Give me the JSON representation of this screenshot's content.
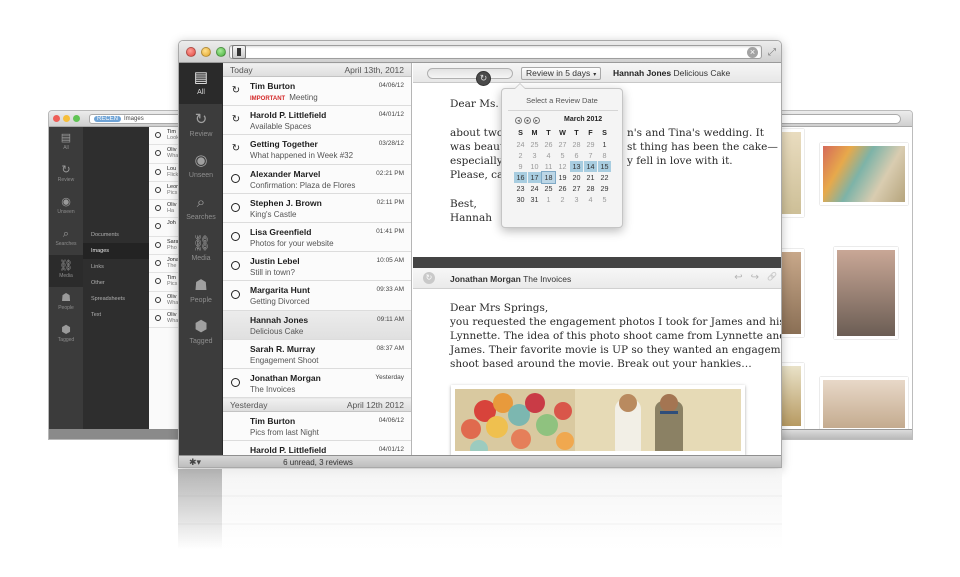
{
  "colors": {
    "sidebar_bg": "#3c3c3c",
    "important": "#d42a2a",
    "selected_day": "#a8cde0",
    "light_red": "#ee5e57",
    "light_yellow": "#f6be3a",
    "light_green": "#60c454"
  },
  "icons": {
    "clear": "×",
    "expand": "⤢",
    "gear": "✱▾",
    "review_loop": "↻",
    "reply": "↩",
    "forward": "↪",
    "attach": "🔗"
  },
  "back_left": {
    "search_pill": "RECEN",
    "search_text": "Images",
    "sidebar": [
      "All",
      "Review",
      "Unseen",
      "Searches",
      "Media",
      "People",
      "Tagged"
    ],
    "sublist": [
      "Documents",
      "Images",
      "Links",
      "Other",
      "Spreadsheets",
      "Text"
    ],
    "rows": [
      {
        "a": "Tim",
        "b": "Look"
      },
      {
        "a": "Oliv",
        "b": "Wha"
      },
      {
        "a": "Lou",
        "b": "Flick"
      },
      {
        "a": "Leon",
        "b": "Pics"
      },
      {
        "a": "Oliv",
        "b": "Ha"
      },
      {
        "a": "Joh",
        "b": ""
      },
      {
        "a": "Sara",
        "b": "Pho"
      },
      {
        "a": "Jona",
        "b": "The"
      },
      {
        "a": "Tim",
        "b": "Pics"
      },
      {
        "a": "Oliv",
        "b": "Wha"
      },
      {
        "a": "Oliv",
        "b": "Wha"
      }
    ]
  },
  "main": {
    "sidebar": [
      {
        "label": "All",
        "glyph": "▤"
      },
      {
        "label": "Review",
        "glyph": "↻"
      },
      {
        "label": "Unseen",
        "glyph": "◉"
      },
      {
        "label": "Searches",
        "glyph": "⌕"
      },
      {
        "label": "Media",
        "glyph": "⛓"
      },
      {
        "label": "People",
        "glyph": "☗"
      },
      {
        "label": "Tagged",
        "glyph": "⬢"
      }
    ],
    "groups": {
      "today": {
        "label": "Today",
        "date": "April 13th, 2012"
      },
      "yesterday": {
        "label": "Yesterday",
        "date": "April 12th 2012"
      }
    },
    "messages": [
      {
        "from": "Tim Burton",
        "important": "IMPORTANT",
        "subject": "Meeting",
        "date": "04/06/12",
        "state": "review"
      },
      {
        "from": "Harold P. Littlefield",
        "important": "",
        "subject": "Available Spaces",
        "date": "04/01/12",
        "state": "review"
      },
      {
        "from": "Getting Together",
        "important": "",
        "subject": "What happened in Week #32",
        "date": "03/28/12",
        "state": "review"
      },
      {
        "from": "Alexander Marvel",
        "important": "",
        "subject": "Confirmation: Plaza de Flores",
        "date": "02:21 PM",
        "state": "circle"
      },
      {
        "from": "Stephen J. Brown",
        "important": "",
        "subject": "King's Castle",
        "date": "02:11 PM",
        "state": "circle"
      },
      {
        "from": "Lisa Greenfield",
        "important": "",
        "subject": "Photos for your website",
        "date": "01:41 PM",
        "state": "circle"
      },
      {
        "from": "Justin Lebel",
        "important": "",
        "subject": "Still in town?",
        "date": "10:05 AM",
        "state": "circle"
      },
      {
        "from": "Margarita Hunt",
        "important": "",
        "subject": "Getting Divorced",
        "date": "09:33 AM",
        "state": "circle"
      },
      {
        "from": "Hannah Jones",
        "important": "",
        "subject": "Delicious Cake",
        "date": "09:11 AM",
        "state": "none"
      },
      {
        "from": "Sarah R. Murray",
        "important": "",
        "subject": "Engagement Shoot",
        "date": "08:37 AM",
        "state": "none"
      },
      {
        "from": "Jonathan Morgan",
        "important": "",
        "subject": "The Invoices",
        "date": "Yesterday",
        "state": "circle"
      }
    ],
    "yesterday_messages": [
      {
        "from": "Tim Burton",
        "subject": "Pics from last Night",
        "date": "04/06/12"
      },
      {
        "from": "Harold P. Littlefield",
        "subject": "",
        "date": "04/01/12"
      }
    ],
    "status": "6 unread, 3 reviews",
    "pane": {
      "review_label": "Review in 5 days",
      "caret": "▾",
      "header1_name": "Hannah Jones",
      "header1_subject": "Delicious Cake",
      "mail1": [
        "Dear Ms. Mi",
        "about two y",
        "n's and Tina's wedding. It",
        "was beautif",
        "st thing has been the cake—",
        "especially i",
        "y fell in love with it.",
        "Please, can",
        "Best,",
        "Hannah"
      ],
      "header2_name": "Jonathan Morgan",
      "header2_subject": "The Invoices",
      "mail2": [
        "Dear Mrs Springs,",
        "you requested the engagement photos I took for James and his girl",
        "Lynnette. The idea of this photo shoot came from Lynnette and",
        "James. Their favorite movie is UP so they wanted an engagement",
        "shoot based around the movie. Break out your hankies…"
      ]
    },
    "calendar": {
      "title": "Select a Review Date",
      "month": "March 2012",
      "nav": [
        "◂",
        "●",
        "▸"
      ],
      "weekdays": [
        "S",
        "M",
        "T",
        "W",
        "T",
        "F",
        "S"
      ],
      "weeks": [
        [
          "24",
          "25",
          "26",
          "27",
          "28",
          "29",
          "1"
        ],
        [
          "2",
          "3",
          "4",
          "5",
          "6",
          "7",
          "8"
        ],
        [
          "9",
          "10",
          "11",
          "12",
          "13",
          "14",
          "15"
        ],
        [
          "16",
          "17",
          "18",
          "19",
          "20",
          "21",
          "22"
        ],
        [
          "23",
          "24",
          "25",
          "26",
          "27",
          "28",
          "29"
        ],
        [
          "30",
          "31",
          "1",
          "2",
          "3",
          "4",
          "5"
        ]
      ],
      "dim": [
        "0-0",
        "0-1",
        "0-2",
        "0-3",
        "0-4",
        "0-5",
        "1-0",
        "1-1",
        "1-2",
        "1-3",
        "1-4",
        "1-5",
        "1-6",
        "2-0",
        "2-1",
        "2-2",
        "2-3",
        "5-2",
        "5-3",
        "5-4",
        "5-5",
        "5-6"
      ],
      "selected": [
        "2-4",
        "2-5",
        "2-6",
        "3-0",
        "3-1"
      ],
      "today": [
        "3-2"
      ]
    }
  }
}
